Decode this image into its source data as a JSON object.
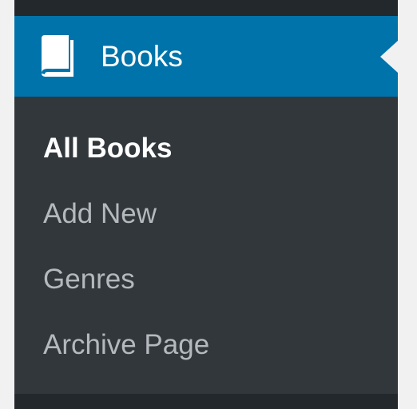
{
  "menu": {
    "active": {
      "label": "Books",
      "icon": "book-icon"
    },
    "submenu": [
      {
        "label": "All Books",
        "current": true
      },
      {
        "label": "Add New",
        "current": false
      },
      {
        "label": "Genres",
        "current": false
      },
      {
        "label": "Archive Page",
        "current": false
      }
    ]
  },
  "colors": {
    "menu_bg": "#32373c",
    "menu_dark": "#23282d",
    "active_bg": "#0073aa",
    "page_bg": "#f1f1f1",
    "submenu_text": "#b4b9be",
    "current_text": "#ffffff"
  }
}
